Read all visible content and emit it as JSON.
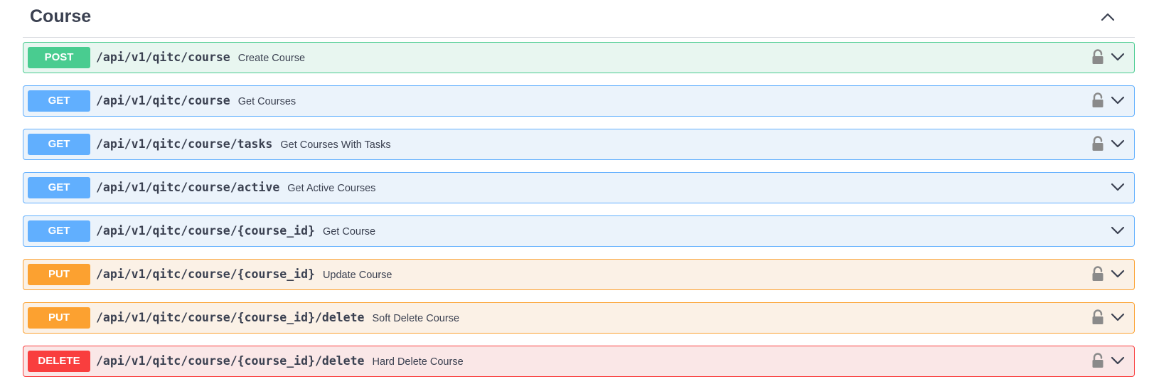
{
  "section": {
    "title": "Course"
  },
  "operations": [
    {
      "method": "POST",
      "path": "/api/v1/qitc/course",
      "summary": "Create Course",
      "locked": true
    },
    {
      "method": "GET",
      "path": "/api/v1/qitc/course",
      "summary": "Get Courses",
      "locked": true
    },
    {
      "method": "GET",
      "path": "/api/v1/qitc/course/tasks",
      "summary": "Get Courses With Tasks",
      "locked": true
    },
    {
      "method": "GET",
      "path": "/api/v1/qitc/course/active",
      "summary": "Get Active Courses",
      "locked": false
    },
    {
      "method": "GET",
      "path": "/api/v1/qitc/course/{course_id}",
      "summary": "Get Course",
      "locked": false
    },
    {
      "method": "PUT",
      "path": "/api/v1/qitc/course/{course_id}",
      "summary": "Update Course",
      "locked": true
    },
    {
      "method": "PUT",
      "path": "/api/v1/qitc/course/{course_id}/delete",
      "summary": "Soft Delete Course",
      "locked": true
    },
    {
      "method": "DELETE",
      "path": "/api/v1/qitc/course/{course_id}/delete",
      "summary": "Hard Delete Course",
      "locked": true
    }
  ],
  "icons": {
    "collapse": "chevron-up-icon",
    "expand": "chevron-down-icon",
    "lock": "lock-icon"
  },
  "colors": {
    "post": "#49cc90",
    "get": "#61affe",
    "put": "#fca130",
    "delete": "#f93e3e",
    "text": "#3b4151",
    "lock": "#8a8a8a"
  }
}
